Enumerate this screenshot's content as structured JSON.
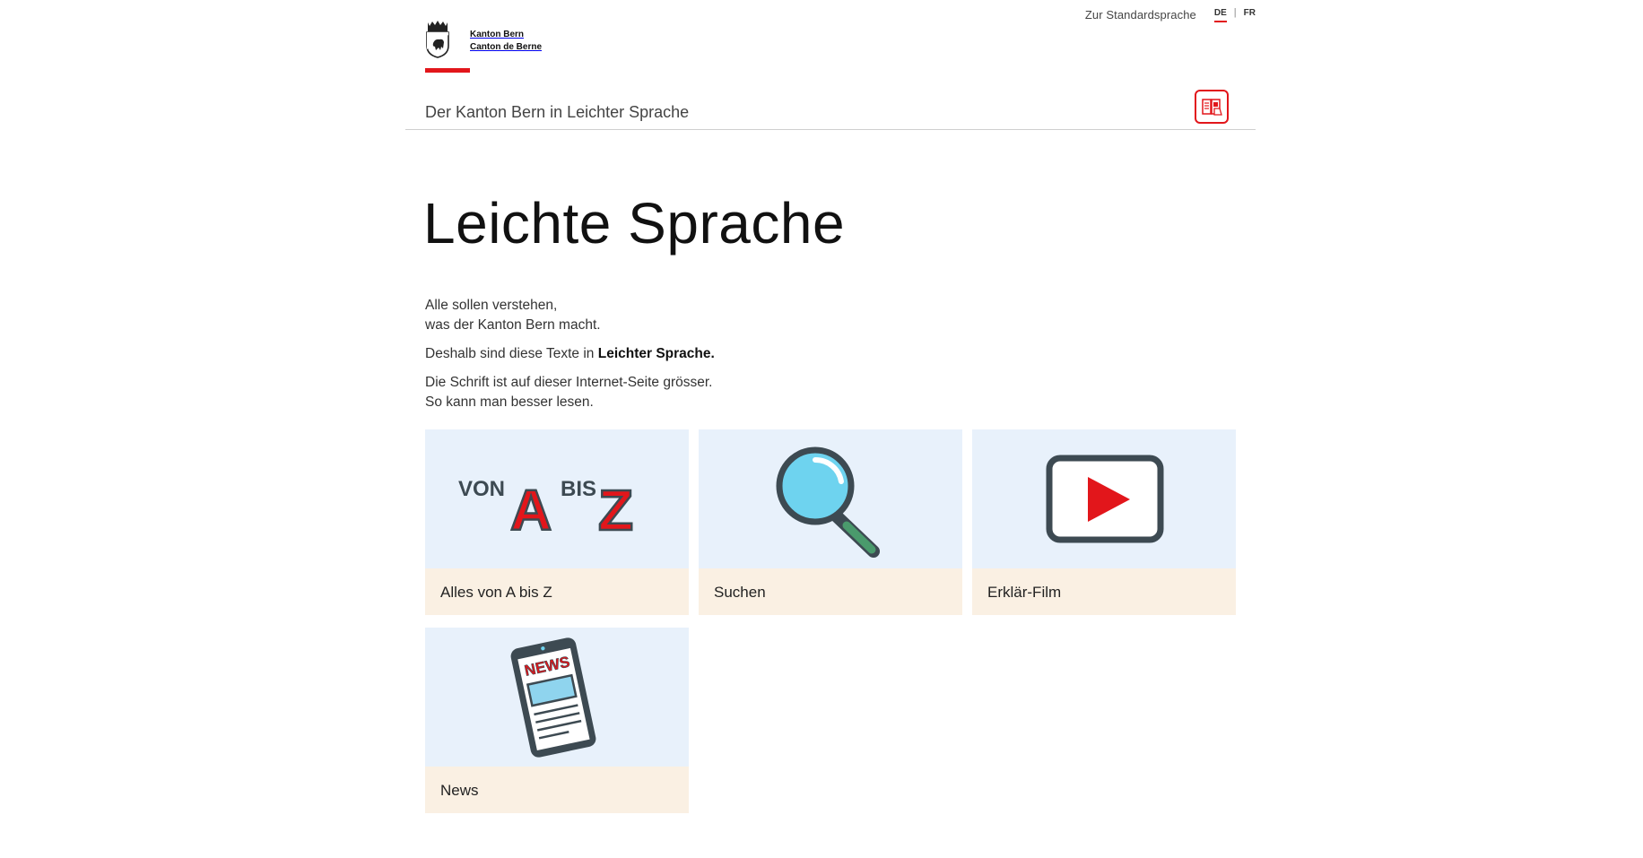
{
  "header": {
    "standard_language_link": "Zur Standardsprache",
    "languages": [
      {
        "code": "DE",
        "active": true
      },
      {
        "code": "FR",
        "active": false
      }
    ],
    "logo_line1": "Kanton Bern",
    "logo_line2": "Canton de Berne",
    "subtitle": "Der Kanton Bern in Leichter Sprache",
    "easy_language_icon": "easy-language-book-icon"
  },
  "main": {
    "title": "Leichte Sprache",
    "intro": {
      "p1_line1": "Alle sollen verstehen,",
      "p1_line2": "was der Kanton Bern macht.",
      "p2_prefix": "Deshalb sind diese Texte in ",
      "p2_bold": "Leichter Sprache.",
      "p3_line1": "Die Schrift ist auf dieser Internet-Seite grösser.",
      "p3_line2": "So kann man besser lesen."
    },
    "tiles": [
      {
        "label": "Alles von A bis Z",
        "icon": "a-to-z-icon",
        "art_von": "VON",
        "art_a": "A",
        "art_bis": "BIS",
        "art_z": "Z"
      },
      {
        "label": "Suchen",
        "icon": "magnifier-icon"
      },
      {
        "label": "Erklär-Film",
        "icon": "video-play-icon"
      },
      {
        "label": "News",
        "icon": "news-phone-icon",
        "art_news": "NEWS"
      }
    ]
  },
  "colors": {
    "accent_red": "#e2161b",
    "tile_image_bg": "#e8f1fb",
    "tile_label_bg": "#faf0e3"
  }
}
